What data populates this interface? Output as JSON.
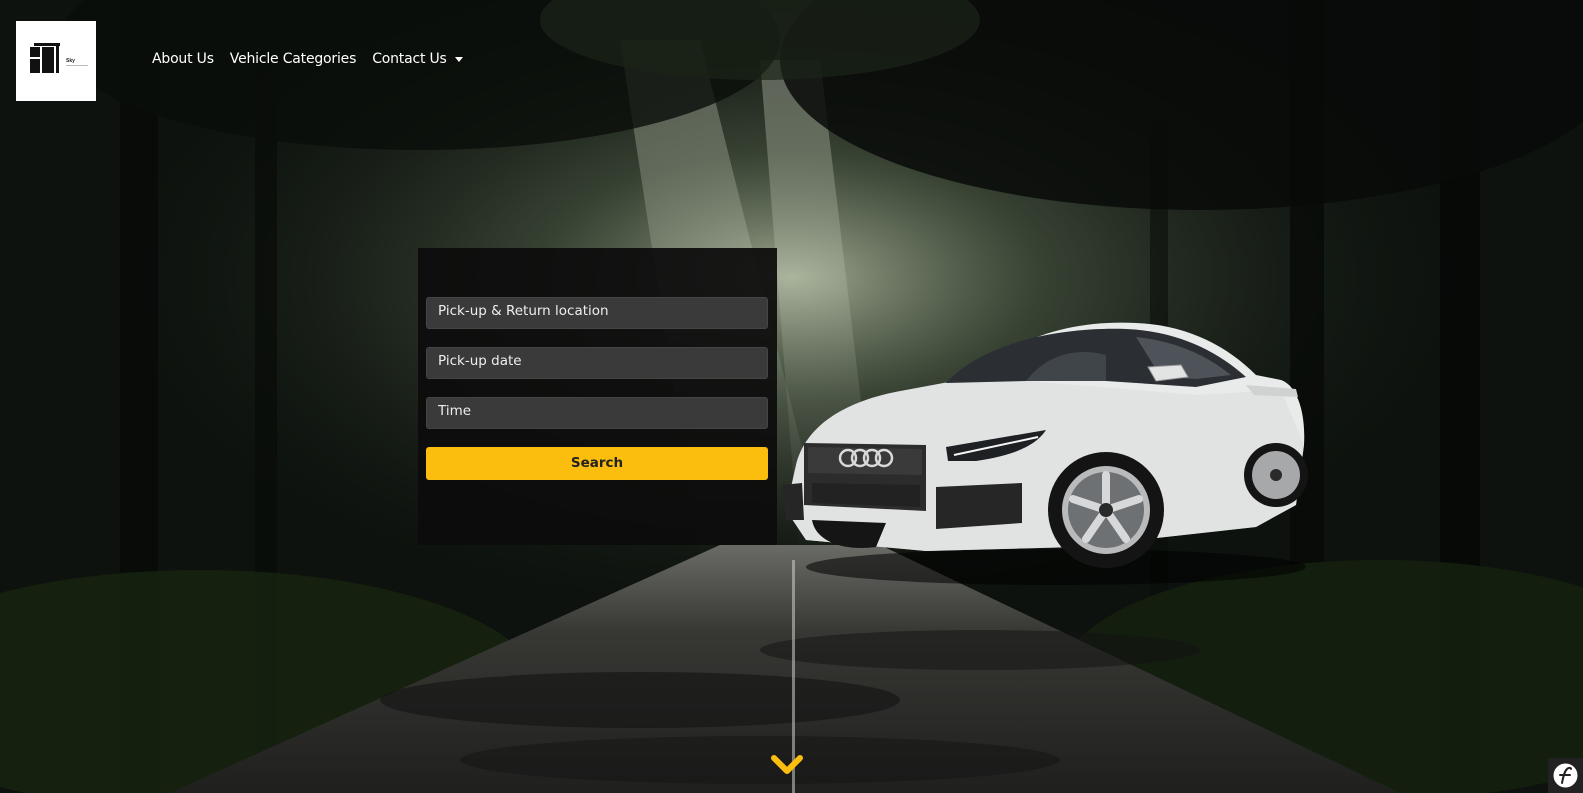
{
  "header": {
    "logo": {
      "icon": "brand-logo",
      "text": "Sky"
    },
    "nav": {
      "about": "About Us",
      "categories": "Vehicle Categories",
      "contact": "Contact Us"
    }
  },
  "booking_form": {
    "location_placeholder": "Pick-up & Return location",
    "date_placeholder": "Pick-up date",
    "time_placeholder": "Time",
    "search_label": "Search"
  },
  "colors": {
    "accent": "#fbbd0e",
    "field_bg": "#3a3a3a",
    "panel_bg": "#0c0c0c"
  },
  "icons": {
    "scroll": "chevron-down-icon",
    "toolbar": "symfony-icon"
  }
}
